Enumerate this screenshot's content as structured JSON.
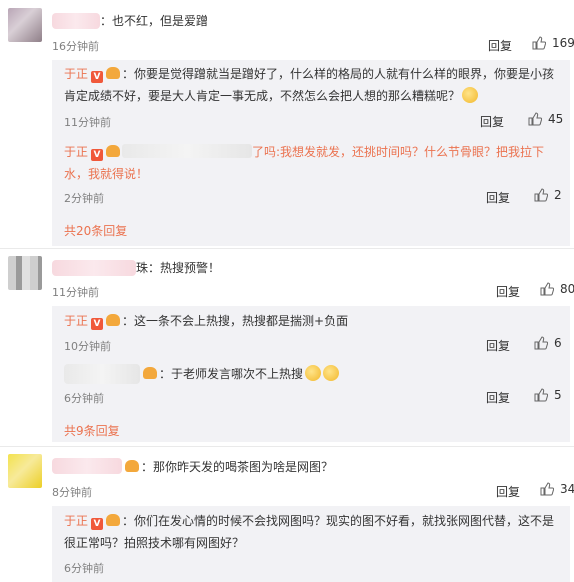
{
  "comments": [
    {
      "text": "：也不红，但是爱蹭",
      "time": "16分钟前",
      "reply": "回复",
      "likes": "169",
      "replies": [
        {
          "author": "于正",
          "text": "：你要是觉得蹭就当是蹭好了，什么样的格局的人就有什么样的眼界，你要是小孩肯定成绩不好，要是大人肯定一事无成，不然怎么会把人想的那么糟糕呢？",
          "time": "11分钟前",
          "reply": "回复",
          "likes": "45"
        },
        {
          "author": "于正",
          "text_tail": "了吗:我想发就发，还挑时间吗？什么节骨眼？把我拉下水，我就得说！",
          "time": "2分钟前",
          "reply": "回复",
          "likes": "2"
        }
      ],
      "more": "共20条回复"
    },
    {
      "text": "珠：热搜预警！",
      "time": "11分钟前",
      "reply": "回复",
      "likes": "80",
      "replies": [
        {
          "author": "于正",
          "text": "：这一条不会上热搜，热搜都是揣测+负面",
          "time": "10分钟前",
          "reply": "回复",
          "likes": "6"
        },
        {
          "text": "：于老师发言哪次不上热搜",
          "time": "6分钟前",
          "reply": "回复",
          "likes": "5"
        }
      ],
      "more": "共9条回复"
    },
    {
      "text": "：那你昨天发的喝茶图为啥是网图？",
      "time": "8分钟前",
      "reply": "回复",
      "likes": "34",
      "replies": [
        {
          "author": "于正",
          "text": "：你们在发心情的时候不会找网图吗？现实的图不好看，就找张网图代替，这不是很正常吗？拍照技术哪有网图好？",
          "time": "6分钟前"
        }
      ]
    }
  ],
  "icons": {
    "like": "thumbs-up-icon",
    "vip": "v-badge-icon",
    "crown": "crown-icon",
    "emoji": "emoji-icon"
  },
  "colors": {
    "author": "#eb7350",
    "subbox": "#f2f2f5",
    "time": "#808080"
  }
}
